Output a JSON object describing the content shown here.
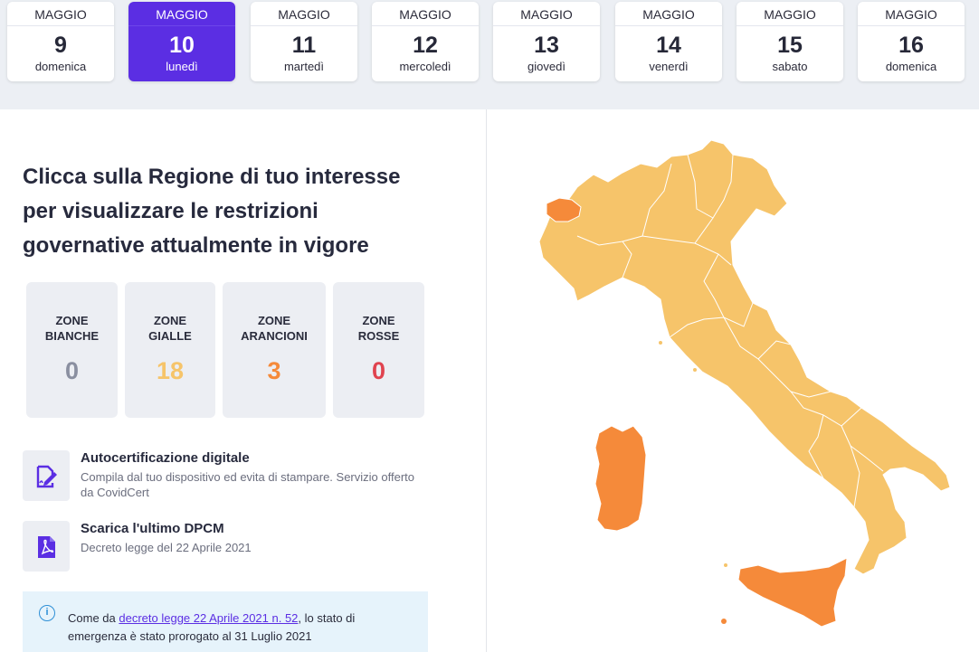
{
  "dates": [
    {
      "month": "MAGGIO",
      "day": "9",
      "weekday": "domenica"
    },
    {
      "month": "MAGGIO",
      "day": "10",
      "weekday": "lunedì"
    },
    {
      "month": "MAGGIO",
      "day": "11",
      "weekday": "martedì"
    },
    {
      "month": "MAGGIO",
      "day": "12",
      "weekday": "mercoledì"
    },
    {
      "month": "MAGGIO",
      "day": "13",
      "weekday": "giovedì"
    },
    {
      "month": "MAGGIO",
      "day": "14",
      "weekday": "venerdì"
    },
    {
      "month": "MAGGIO",
      "day": "15",
      "weekday": "sabato"
    },
    {
      "month": "MAGGIO",
      "day": "16",
      "weekday": "domenica"
    }
  ],
  "selected_date_index": 1,
  "headline": "Clicca sulla Regione di tuo interesse per visualizzare le restrizioni governative attualmente in vigore",
  "zones": [
    {
      "line1": "ZONE",
      "line2": "BIANCHE",
      "count": "0",
      "color": "#8a8fa0"
    },
    {
      "line1": "ZONE",
      "line2": "GIALLE",
      "count": "18",
      "color": "#f6c46a"
    },
    {
      "line1": "ZONE",
      "line2": "ARANCIONI",
      "count": "3",
      "color": "#f58a3a"
    },
    {
      "line1": "ZONE",
      "line2": "ROSSE",
      "count": "0",
      "color": "#e0434f"
    }
  ],
  "autocert": {
    "icon": "edit-document-icon",
    "title": "Autocertificazione digitale",
    "description": "Compila dal tuo dispositivo ed evita di stampare. Servizio offerto da CovidCert"
  },
  "dpcm": {
    "icon": "pdf-file-icon",
    "title": "Scarica l'ultimo DPCM",
    "description": "Decreto legge del 22 Aprile 2021"
  },
  "notice": {
    "icon": "info-icon",
    "prefix": "Come da ",
    "link_text": "decreto legge 22 Aprile 2021 n. 52",
    "suffix": ", lo stato di emergenza è stato prorogato al 31 Luglio 2021"
  },
  "colors": {
    "accent": "#5b2ee3",
    "yellow_zone": "#f6c46a",
    "orange_zone": "#f58a3a"
  },
  "map": {
    "orange_regions": [
      "Valle d'Aosta",
      "Sardegna",
      "Sicilia"
    ],
    "yellow_regions_count": 18
  }
}
